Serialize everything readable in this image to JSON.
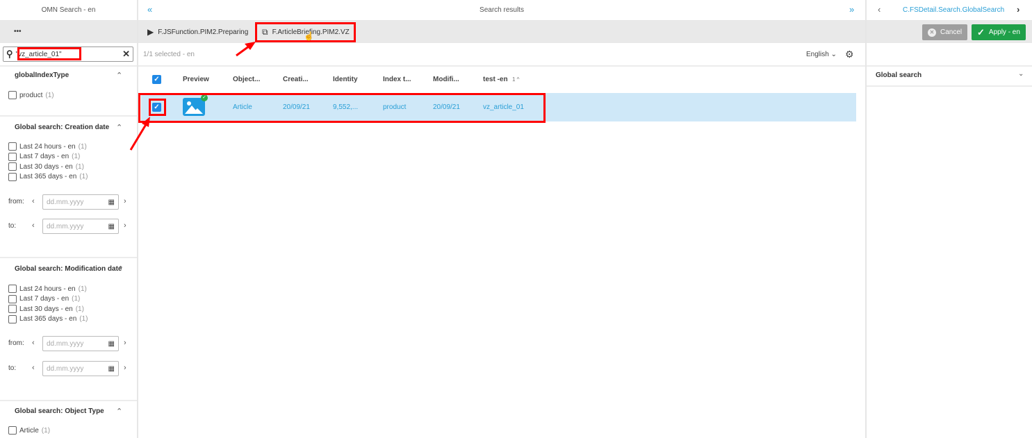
{
  "left": {
    "title": "OMN Search - en",
    "more": "•••",
    "search_value": "\"vz_article_01\"",
    "sections": [
      {
        "title": "globalIndexType",
        "options": [
          {
            "label": "product",
            "count": "(1)"
          }
        ]
      },
      {
        "title": "Global search: Creation date",
        "options": [
          {
            "label": "Last 24 hours - en",
            "count": "(1)"
          },
          {
            "label": "Last 7 days - en",
            "count": "(1)"
          },
          {
            "label": "Last 30 days - en",
            "count": "(1)"
          },
          {
            "label": "Last 365 days - en",
            "count": "(1)"
          }
        ],
        "from_label": "from:",
        "to_label": "to:",
        "placeholder": "dd.mm.yyyy"
      },
      {
        "title": "Global search: Modification date",
        "options": [
          {
            "label": "Last 24 hours - en",
            "count": "(1)"
          },
          {
            "label": "Last 7 days - en",
            "count": "(1)"
          },
          {
            "label": "Last 30 days - en",
            "count": "(1)"
          },
          {
            "label": "Last 365 days - en",
            "count": "(1)"
          }
        ],
        "from_label": "from:",
        "to_label": "to:",
        "placeholder": "dd.mm.yyyy"
      },
      {
        "title": "Global search: Object Type",
        "options": [
          {
            "label": "Article",
            "count": "(1)"
          }
        ]
      }
    ]
  },
  "center": {
    "title": "Search results",
    "actions": [
      "F.JSFunction.PIM2.Preparing",
      "F.ArticleBriefing.PIM2.VZ"
    ],
    "selected": "1/1 selected - en",
    "language": "English",
    "columns": [
      "Preview",
      "Object...",
      "Creati...",
      "Identity",
      "Index t...",
      "Modifi...",
      "test -en"
    ],
    "sort_indicator": "1 ^",
    "rows": [
      {
        "object": "Article",
        "created": "20/09/21",
        "identity": "9,552,...",
        "index": "product",
        "modified": "20/09/21",
        "test": "vz_article_01",
        "selected": true
      }
    ]
  },
  "right": {
    "title": "C.FSDetail.Search.GlobalSearch",
    "cancel": "Cancel",
    "apply": "Apply - en",
    "section": "Global search"
  },
  "colors": {
    "accent": "#2a9fd6",
    "apply": "#1fa049",
    "cancel": "#9e9e9e",
    "selected_row": "#cfe8f8",
    "annotation": "#ff0000"
  }
}
